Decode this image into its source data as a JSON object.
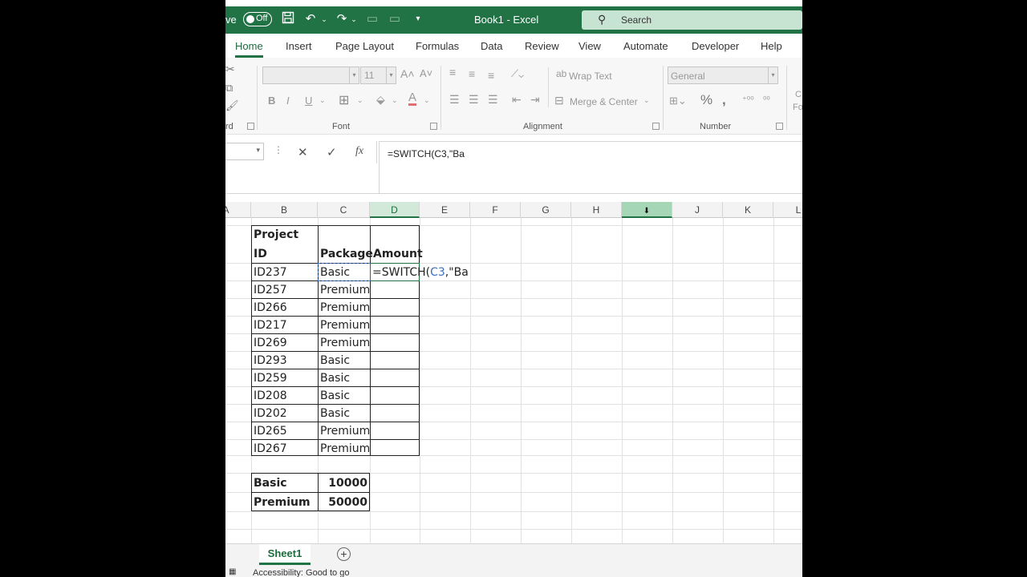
{
  "titlebar": {
    "autosave_fragment": "ve",
    "autosave_state": "Off",
    "doc_title": "Book1  -  Excel",
    "search_placeholder": "Search"
  },
  "tabs": [
    "Home",
    "Insert",
    "Page Layout",
    "Formulas",
    "Data",
    "Review",
    "View",
    "Automate",
    "Developer",
    "Help"
  ],
  "ribbon": {
    "font_size": "11",
    "wrap_text": "Wrap Text",
    "merge_center": "Merge & Center",
    "number_format": "General",
    "groups": {
      "clipboard_fragment": "rd",
      "font": "Font",
      "alignment": "Alignment",
      "number": "Number"
    },
    "styles_fragment": "C",
    "styles_fragment2": "Fo"
  },
  "formula_bar": {
    "content": "=SWITCH(C3,\"Ba"
  },
  "columns": [
    "A",
    "B",
    "C",
    "D",
    "E",
    "F",
    "G",
    "H",
    "I",
    "J",
    "K",
    "L"
  ],
  "table": {
    "header_b_line1": "Project",
    "header_b_line2": "ID",
    "header_c": "Package",
    "header_d": "Amount",
    "rows": [
      {
        "id": "ID237",
        "package": "Basic"
      },
      {
        "id": "ID257",
        "package": "Premium"
      },
      {
        "id": "ID266",
        "package": "Premium"
      },
      {
        "id": "ID217",
        "package": "Premium"
      },
      {
        "id": "ID269",
        "package": "Premium"
      },
      {
        "id": "ID293",
        "package": "Basic"
      },
      {
        "id": "ID259",
        "package": "Basic"
      },
      {
        "id": "ID208",
        "package": "Basic"
      },
      {
        "id": "ID202",
        "package": "Basic"
      },
      {
        "id": "ID265",
        "package": "Premium"
      },
      {
        "id": "ID267",
        "package": "Premium"
      }
    ],
    "editing_formula_prefix": "=SWITCH(",
    "editing_formula_ref": "C3",
    "editing_formula_suffix": ",\"Ba"
  },
  "lookup": [
    {
      "package": "Basic",
      "amount": "10000"
    },
    {
      "package": "Premium",
      "amount": "50000"
    }
  ],
  "sheet_tab": "Sheet1",
  "status": "Accessibility: Good to go"
}
